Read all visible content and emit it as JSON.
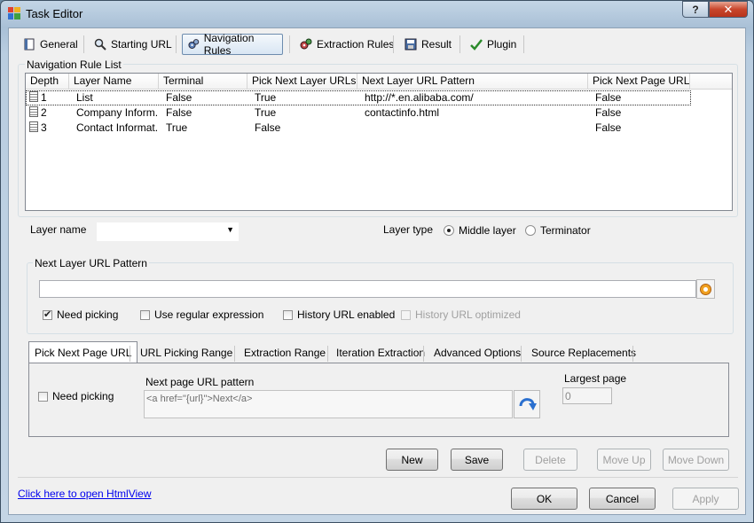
{
  "window": {
    "title": "Task Editor",
    "help_label": "?",
    "close_label": "✕"
  },
  "main_tabs": [
    {
      "label": "General",
      "icon": "document-icon"
    },
    {
      "label": "Starting URL",
      "icon": "magnifier-icon"
    },
    {
      "label": "Navigation Rules",
      "icon": "gears-icon"
    },
    {
      "label": "Extraction Rules",
      "icon": "gears-red-icon"
    },
    {
      "label": "Result",
      "icon": "floppy-icon"
    },
    {
      "label": "Plugin",
      "icon": "checkmark-icon"
    }
  ],
  "rule_list": {
    "legend": "Navigation Rule List",
    "columns": [
      "Depth",
      "Layer Name",
      "Terminal",
      "Pick Next Layer URLs",
      "Next Layer URL Pattern",
      "Pick Next Page URL"
    ],
    "rows": [
      [
        "1",
        "List",
        "False",
        "True",
        "http://*.en.alibaba.com/",
        "False"
      ],
      [
        "2",
        "Company Inform...",
        "False",
        "True",
        "contactinfo.html",
        "False"
      ],
      [
        "3",
        "Contact Informat...",
        "True",
        "False",
        "",
        "False"
      ]
    ]
  },
  "layer": {
    "name_label": "Layer name",
    "name_value": "",
    "type_label": "Layer type",
    "middle_label": "Middle layer",
    "terminator_label": "Terminator"
  },
  "pattern_group": {
    "legend": "Next Layer URL Pattern",
    "value": "",
    "need_picking": "Need picking",
    "use_regex": "Use regular expression",
    "history_enabled": "History URL enabled",
    "history_optimized": "History URL optimized"
  },
  "sub_tabs": [
    "Pick Next Page URL",
    "URL Picking Range",
    "Extraction Range",
    "Iteration Extraction",
    "Advanced Options",
    "Source Replacements"
  ],
  "next_page": {
    "need_picking": "Need picking",
    "pattern_label": "Next page URL pattern",
    "pattern_value": "<a href=\"{url}\">Next</a>",
    "largest_label": "Largest page",
    "largest_value": "0"
  },
  "actions": {
    "new": "New",
    "save": "Save",
    "delete": "Delete",
    "move_up": "Move Up",
    "move_down": "Move Down"
  },
  "footer": {
    "link": "Click here to open HtmlView",
    "ok": "OK",
    "cancel": "Cancel",
    "apply": "Apply"
  }
}
